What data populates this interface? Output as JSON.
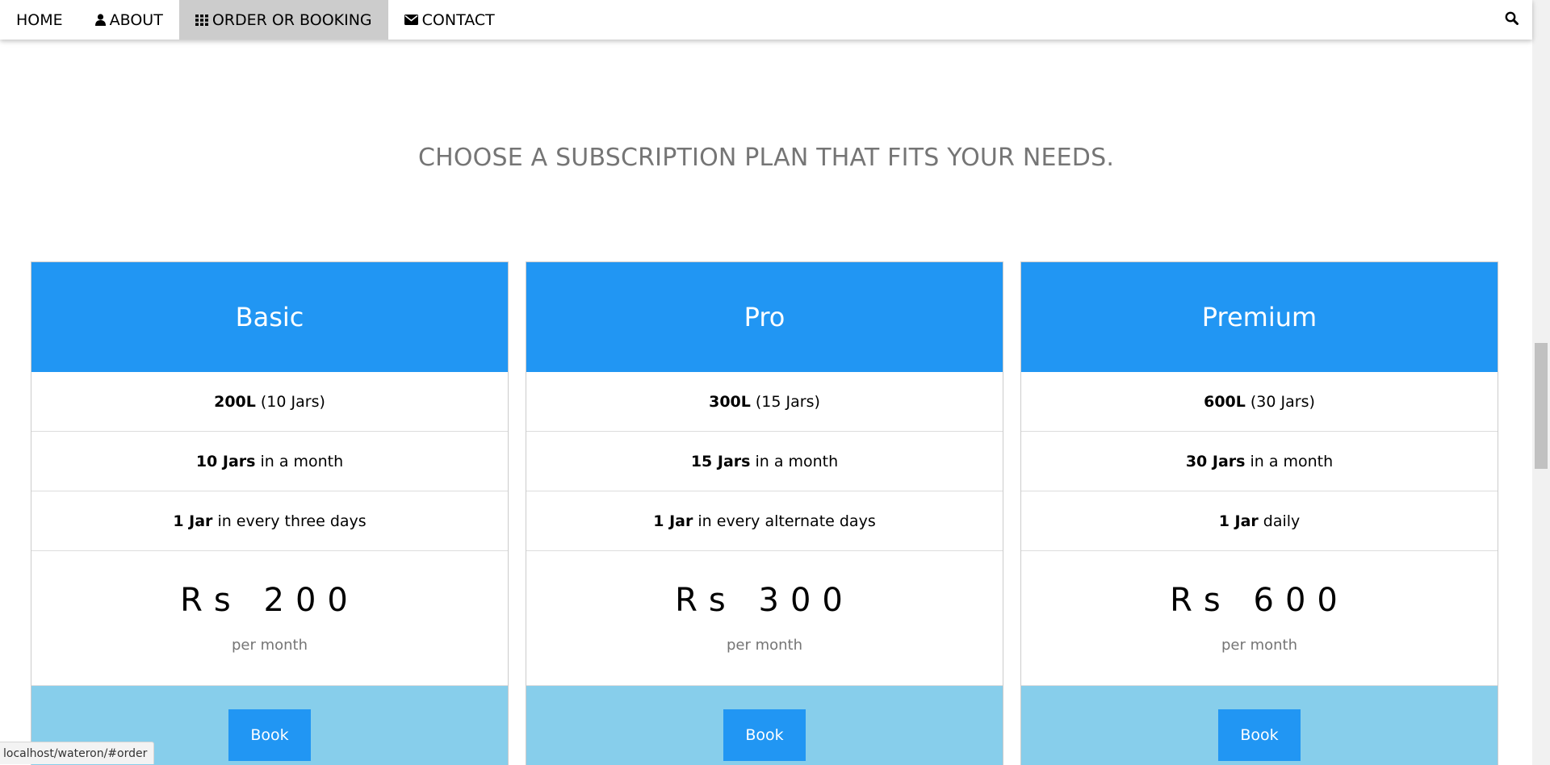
{
  "nav": {
    "items": [
      {
        "label": "HOME",
        "icon": "",
        "active": false
      },
      {
        "label": "ABOUT",
        "icon": "user-icon",
        "active": false
      },
      {
        "label": "ORDER OR BOOKING",
        "icon": "grid-icon",
        "active": true
      },
      {
        "label": "CONTACT",
        "icon": "envelope-icon",
        "active": false
      }
    ],
    "search_icon": "search-icon"
  },
  "heading": "CHOOSE A SUBSCRIPTION PLAN THAT FITS YOUR NEEDS.",
  "plans": [
    {
      "name": "Basic",
      "volume_bold": "200L",
      "volume_text": "(10 Jars)",
      "monthly_bold": "10 Jars",
      "monthly_text": "in a month",
      "frequency_bold": "1 Jar",
      "frequency_text": "in every three days",
      "price": "Rs 200",
      "period": "per month",
      "button": "Book"
    },
    {
      "name": "Pro",
      "volume_bold": "300L",
      "volume_text": "(15 Jars)",
      "monthly_bold": "15 Jars",
      "monthly_text": "in a month",
      "frequency_bold": "1 Jar",
      "frequency_text": "in every alternate days",
      "price": "Rs 300",
      "period": "per month",
      "button": "Book"
    },
    {
      "name": "Premium",
      "volume_bold": "600L",
      "volume_text": "(30 Jars)",
      "monthly_bold": "30 Jars",
      "monthly_text": "in a month",
      "frequency_bold": "1 Jar",
      "frequency_text": "daily",
      "price": "Rs 600",
      "period": "per month",
      "button": "Book"
    }
  ],
  "status_bar": {
    "url": "localhost/wateron/#order"
  },
  "colors": {
    "header_blue": "#2196f3",
    "footer_light_blue": "#87ceeb",
    "active_nav": "#cccccc",
    "heading_gray": "#757575"
  }
}
